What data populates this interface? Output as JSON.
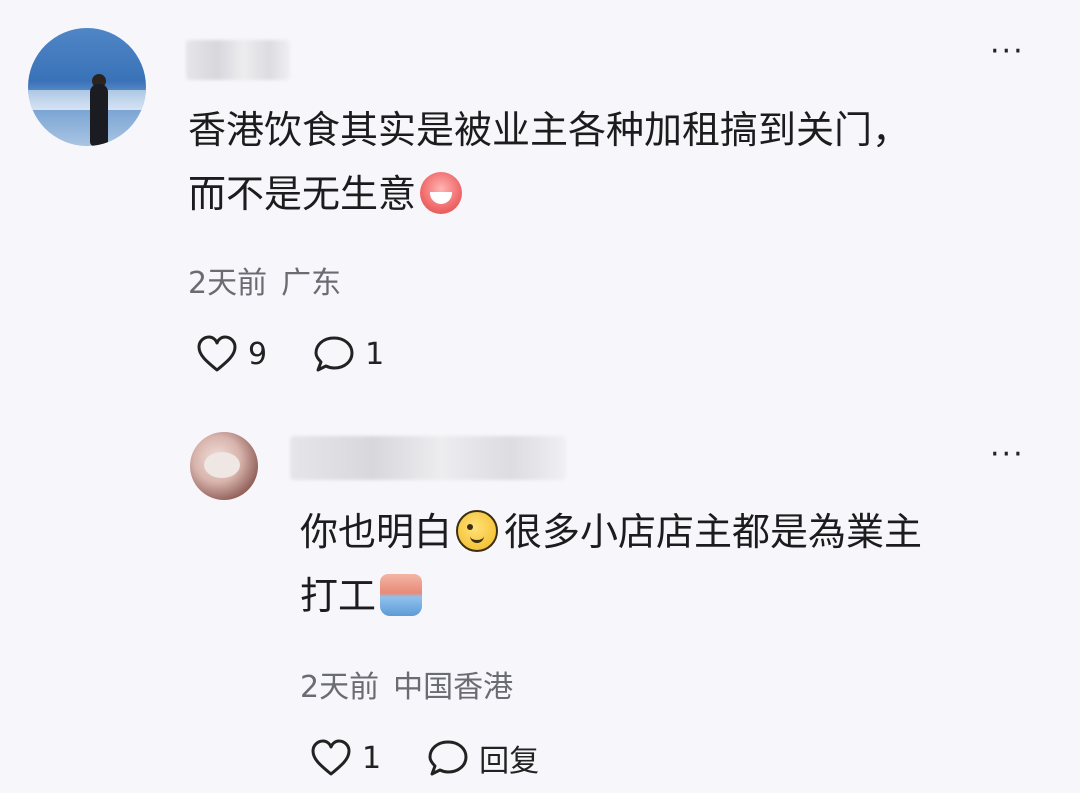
{
  "comment": {
    "text_line1": "香港饮食其实是被业主各种加租搞到关门，",
    "text_line2": "而不是无生意",
    "time": "2天前",
    "location": "广东",
    "likes": "9",
    "replies": "1"
  },
  "reply": {
    "text_line1_a": "你也明白",
    "text_line1_b": "很多小店店主都是為業主",
    "text_line2": "打工",
    "time": "2天前",
    "location": "中国香港",
    "likes": "1",
    "reply_label": "回复"
  },
  "icons": {
    "more": "more-dots-icon",
    "like": "heart-outline-icon",
    "comment": "speech-bubble-icon"
  },
  "colors": {
    "background": "#f7f7fb",
    "text": "#1c1c1e",
    "meta": "#6b6b72"
  }
}
